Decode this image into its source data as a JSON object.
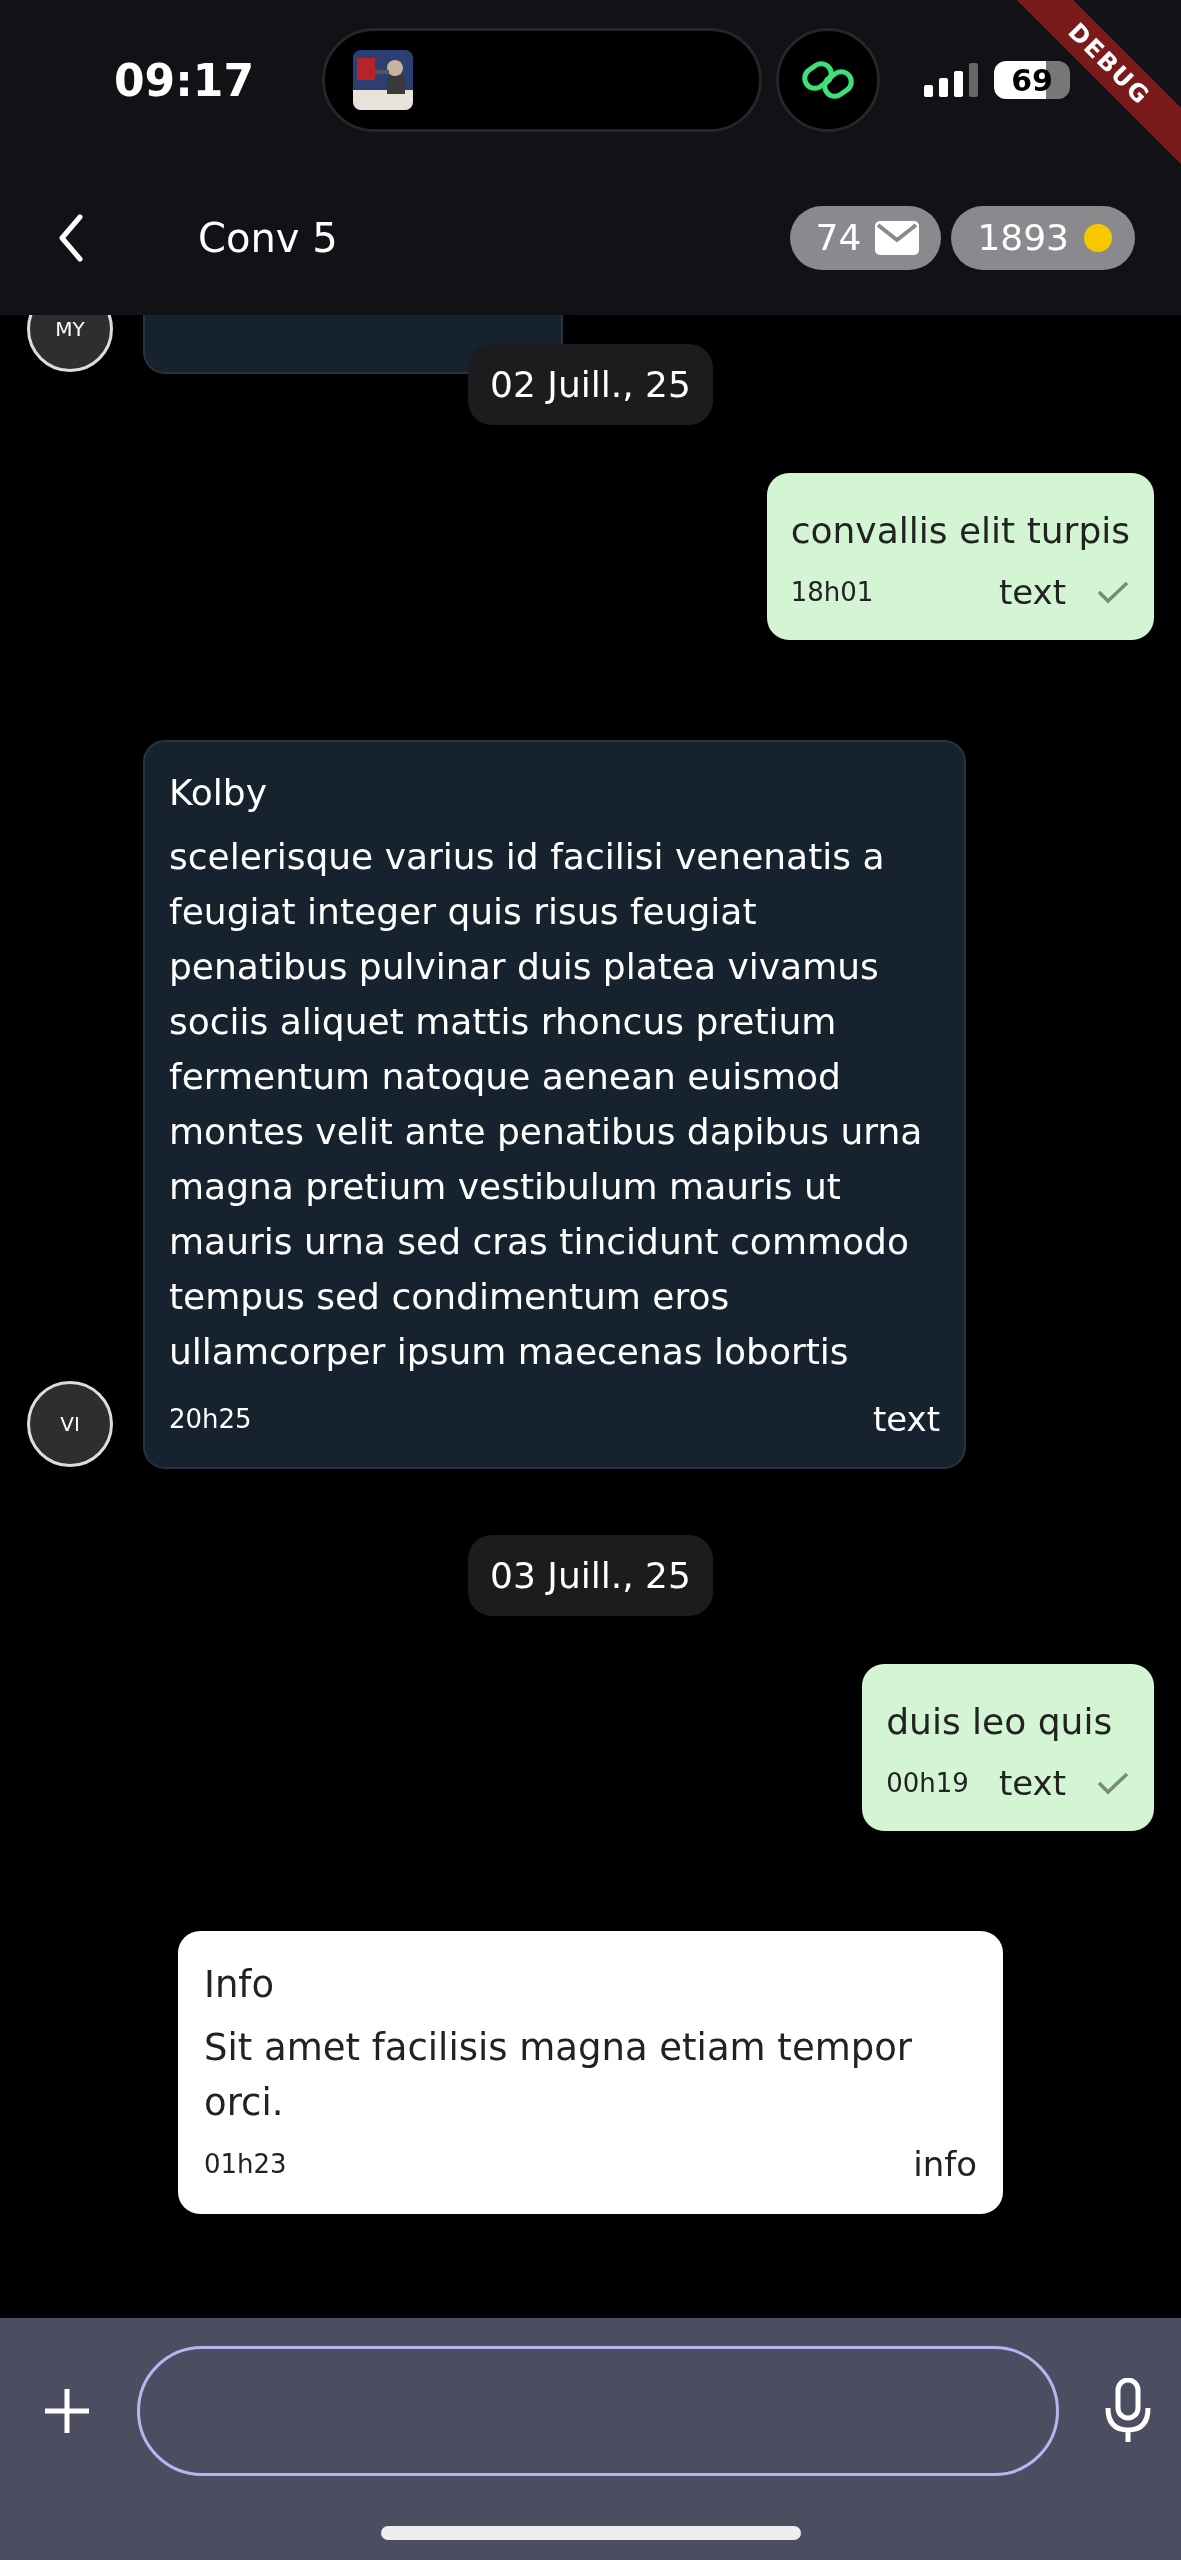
{
  "status_bar": {
    "time": "09:17",
    "battery": "69"
  },
  "debug_banner": "DEBUG",
  "header": {
    "title": "Conv 5",
    "badges": [
      {
        "kind": "mail",
        "count": "74"
      },
      {
        "kind": "coin",
        "count": "1893"
      }
    ]
  },
  "messages": [
    {
      "kind": "received",
      "avatar": "MY"
    },
    {
      "kind": "date",
      "label": "02 Juill., 25"
    },
    {
      "kind": "sent",
      "text": "convallis elit turpis",
      "time": "18h01",
      "type_label": "text",
      "delivered": true
    },
    {
      "kind": "received",
      "avatar": "VI",
      "sender": "Kolby",
      "text": "scelerisque varius id facilisi venenatis a feugiat integer quis risus feugiat penatibus pulvinar duis platea vivamus sociis aliquet mattis rhoncus pretium fermentum natoque aenean euismod montes velit ante penatibus dapibus urna magna pretium vestibulum mauris ut mauris urna sed cras tincidunt commodo tempus sed condimentum eros ullamcorper ipsum maecenas lobortis",
      "time": "20h25",
      "type_label": "text"
    },
    {
      "kind": "date",
      "label": "03 Juill., 25"
    },
    {
      "kind": "sent",
      "text": "duis leo quis",
      "time": "00h19",
      "type_label": "text",
      "delivered": true
    },
    {
      "kind": "info",
      "title": "Info",
      "text": "Sit amet facilisis magna etiam tempor orci.",
      "time": "01h23",
      "type_label": "info"
    }
  ]
}
